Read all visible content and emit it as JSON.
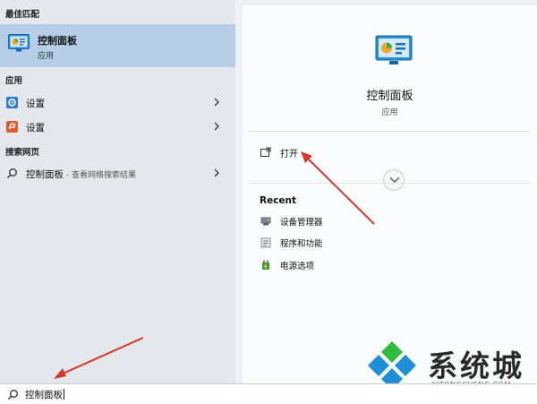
{
  "left": {
    "best_match_header": "最佳匹配",
    "best_match": {
      "title": "控制面板",
      "subtitle": "应用",
      "icon": "control-panel-icon"
    },
    "apps_header": "应用",
    "apps": [
      {
        "label": "设置",
        "icon": "settings-gear-icon"
      },
      {
        "label": "设置",
        "icon": "settings-orange-icon"
      }
    ],
    "web_header": "搜索网页",
    "web_result": {
      "label": "控制面板",
      "suffix": " - 查看网络搜索结果",
      "icon": "search-icon"
    }
  },
  "right": {
    "app_name": "控制面板",
    "app_type": "应用",
    "open_label": "打开",
    "recent_title": "Recent",
    "recent": [
      {
        "label": "设备管理器",
        "icon": "device-manager-icon"
      },
      {
        "label": "程序和功能",
        "icon": "programs-features-icon"
      },
      {
        "label": "电源选项",
        "icon": "power-options-icon"
      }
    ]
  },
  "search": {
    "value": "控制面板"
  },
  "watermark": {
    "cn": "系统城",
    "en": "XITONGCHENG.COM"
  },
  "colors": {
    "selection": "#b6cfe6",
    "annotation": "#d6362b",
    "watermark_blue": "#1e8fd5"
  }
}
